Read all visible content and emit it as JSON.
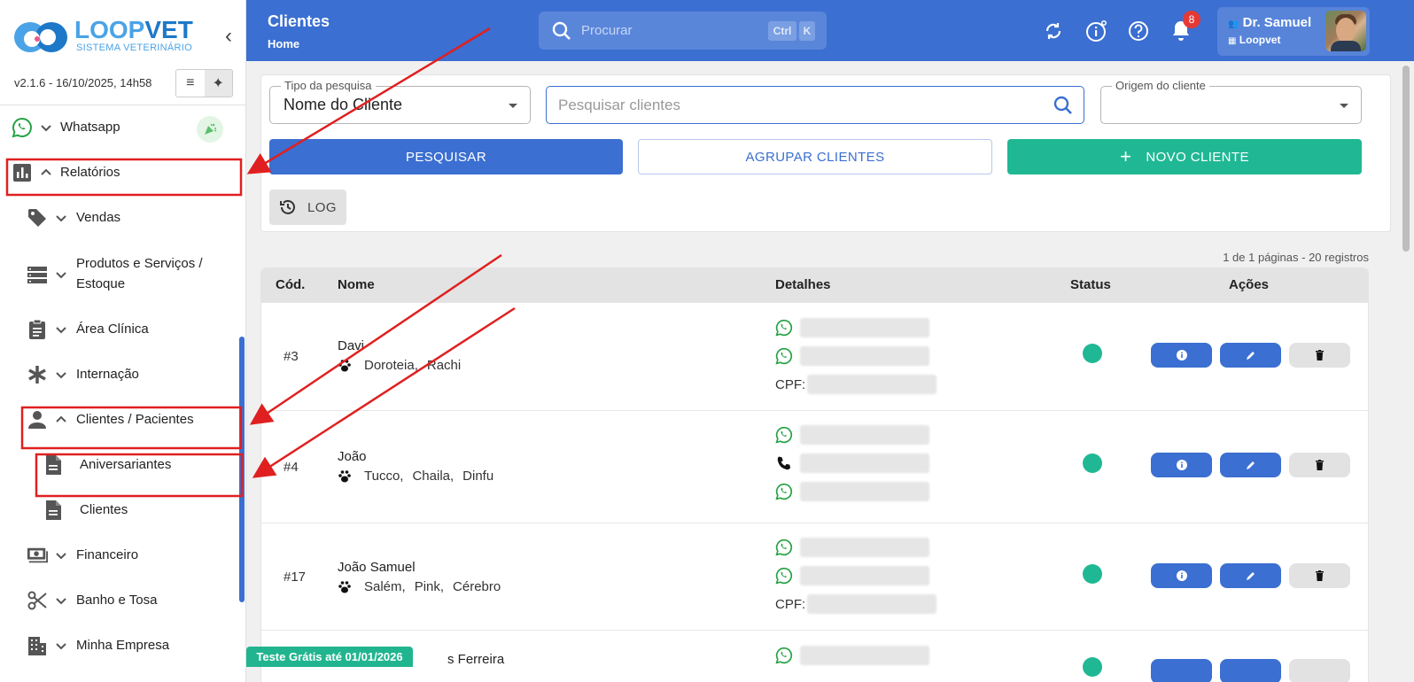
{
  "brand": {
    "name_part1": "LOOP",
    "name_part2": "VET",
    "subtitle": "SISTEMA VETERINÁRIO"
  },
  "version": "v2.1.6 - 16/10/2025, 14h58",
  "sidebar": {
    "items": [
      {
        "label": "Whatsapp",
        "icon": "whatsapp-icon"
      },
      {
        "label": "Relatórios",
        "icon": "bar-chart-icon"
      },
      {
        "label": "Vendas",
        "icon": "tag-icon"
      },
      {
        "label": "Produtos e Serviços /",
        "label2": "Estoque",
        "icon": "list-icon"
      },
      {
        "label": "Área Clínica",
        "icon": "clipboard-icon"
      },
      {
        "label": "Internação",
        "icon": "asterisk-icon"
      },
      {
        "label": "Clientes / Pacientes",
        "icon": "person-icon"
      },
      {
        "label": "Aniversariantes",
        "icon": "document-icon"
      },
      {
        "label": "Clientes",
        "icon": "document-icon"
      },
      {
        "label": "Financeiro",
        "icon": "money-icon"
      },
      {
        "label": "Banho e Tosa",
        "icon": "scissors-icon"
      },
      {
        "label": "Minha Empresa",
        "icon": "building-icon"
      }
    ]
  },
  "trial_badge": "Teste Grátis até 01/01/2026",
  "header": {
    "title": "Clientes",
    "breadcrumb": "Home",
    "search_placeholder": "Procurar",
    "kbd1": "Ctrl",
    "kbd2": "K",
    "notifications_count": "8",
    "user_name": "Dr. Samuel",
    "user_org": "Loopvet"
  },
  "filters": {
    "tipo_label": "Tipo da pesquisa",
    "tipo_value": "Nome do Cliente",
    "search_placeholder": "Pesquisar clientes",
    "origem_label": "Origem do cliente",
    "btn_pesquisar": "PESQUISAR",
    "btn_agrupar": "AGRUPAR CLIENTES",
    "btn_novo": "NOVO CLIENTE",
    "btn_log": "LOG"
  },
  "pagination_info": "1 de 1 páginas - 20 registros",
  "table": {
    "headers": {
      "cod": "Cód.",
      "nome": "Nome",
      "detalhes": "Detalhes",
      "status": "Status",
      "acoes": "Ações"
    },
    "cpf_label": "CPF:",
    "rows": [
      {
        "cod": "#3",
        "nome": "Davi",
        "pets": [
          "Doroteia,",
          "Rachi"
        ]
      },
      {
        "cod": "#4",
        "nome": "João",
        "pets": [
          "Tucco,",
          "Chaila,",
          "Dinfu"
        ]
      },
      {
        "cod": "#17",
        "nome": "João Samuel",
        "pets": [
          "Salém,",
          "Pink,",
          "Cérebro"
        ]
      },
      {
        "cod": "",
        "nome": "s Ferreira",
        "pets": []
      }
    ]
  },
  "colors": {
    "primary": "#3b6fd1",
    "green": "#20b894",
    "annotation": "#e02020"
  }
}
